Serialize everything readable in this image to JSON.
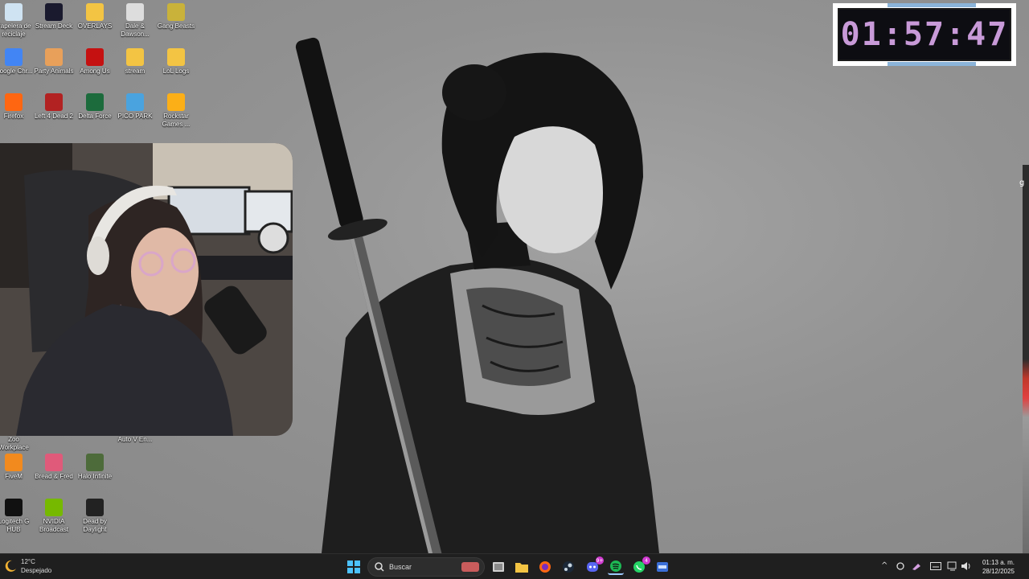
{
  "desktop_icons": [
    {
      "label": "Papelera de reciclaje",
      "icon": "recycle-bin-icon",
      "color": "#cfe3f2"
    },
    {
      "label": "Stream Deck",
      "icon": "stream-deck-icon",
      "color": "#1a1a2e"
    },
    {
      "label": "OVERLAYS",
      "icon": "folder-icon",
      "color": "#f3c443"
    },
    {
      "label": "Dale & Dawson...",
      "icon": "dale-dawson-icon",
      "color": "#dddddd"
    },
    {
      "label": "Gang Beasts",
      "icon": "gang-beasts-icon",
      "color": "#c9b23a"
    },
    {
      "label": "Google Chr...",
      "icon": "chrome-icon",
      "color": "#4285f4"
    },
    {
      "label": "Party Animals",
      "icon": "party-animals-icon",
      "color": "#e8a05a"
    },
    {
      "label": "Among Us",
      "icon": "among-us-icon",
      "color": "#c51111"
    },
    {
      "label": "stream",
      "icon": "folder-icon",
      "color": "#f3c443"
    },
    {
      "label": "LoL Logs",
      "icon": "folder-icon",
      "color": "#f3c443"
    },
    {
      "label": "Firefox",
      "icon": "firefox-icon",
      "color": "#ff6611"
    },
    {
      "label": "Left 4 Dead 2",
      "icon": "left4dead-icon",
      "color": "#b22222"
    },
    {
      "label": "Delta Force",
      "icon": "delta-force-icon",
      "color": "#1c6b3c"
    },
    {
      "label": "PICO PARK",
      "icon": "pico-park-icon",
      "color": "#4aa3df"
    },
    {
      "label": "Rockstar Games ...",
      "icon": "rockstar-icon",
      "color": "#fcaf17"
    },
    {
      "label": "Zoo Workplace",
      "icon": "zoom-icon",
      "color": "#2d8cff"
    },
    {
      "label": "Auto V En...",
      "icon": "autov-icon",
      "color": "#444444"
    },
    {
      "label": "FiveM",
      "icon": "fivem-icon",
      "color": "#f28a1e"
    },
    {
      "label": "Bread & Fred",
      "icon": "bread-fred-icon",
      "color": "#e05a7a"
    },
    {
      "label": "Halo Infinite",
      "icon": "halo-icon",
      "color": "#4d6b3a"
    },
    {
      "label": "Logitech G HUB",
      "icon": "logitech-icon",
      "color": "#111111"
    },
    {
      "label": "NVIDIA Broadcast",
      "icon": "nvidia-icon",
      "color": "#76b900"
    },
    {
      "label": "Dead by Daylight",
      "icon": "dead-by-daylight-icon",
      "color": "#222222"
    }
  ],
  "timer": {
    "value": "01:57:47",
    "color": "#c89ad8",
    "accent": "#8bb4d9"
  },
  "weather": {
    "temp": "12°C",
    "condition": "Despejado"
  },
  "search": {
    "placeholder": "Buscar"
  },
  "taskbar_apps": [
    {
      "icon": "windows-start-icon"
    },
    {
      "icon": "task-view-icon"
    },
    {
      "icon": "file-explorer-icon"
    },
    {
      "icon": "firefox-icon"
    },
    {
      "icon": "steam-icon"
    },
    {
      "icon": "discord-icon",
      "badge": "9+"
    },
    {
      "icon": "spotify-icon"
    },
    {
      "icon": "whatsapp-icon",
      "badge": "4"
    },
    {
      "icon": "mixer-icon"
    }
  ],
  "clock": {
    "time": "01:13 a. m.",
    "date": "28/12/2025"
  },
  "right_edge": {
    "text": "g"
  }
}
